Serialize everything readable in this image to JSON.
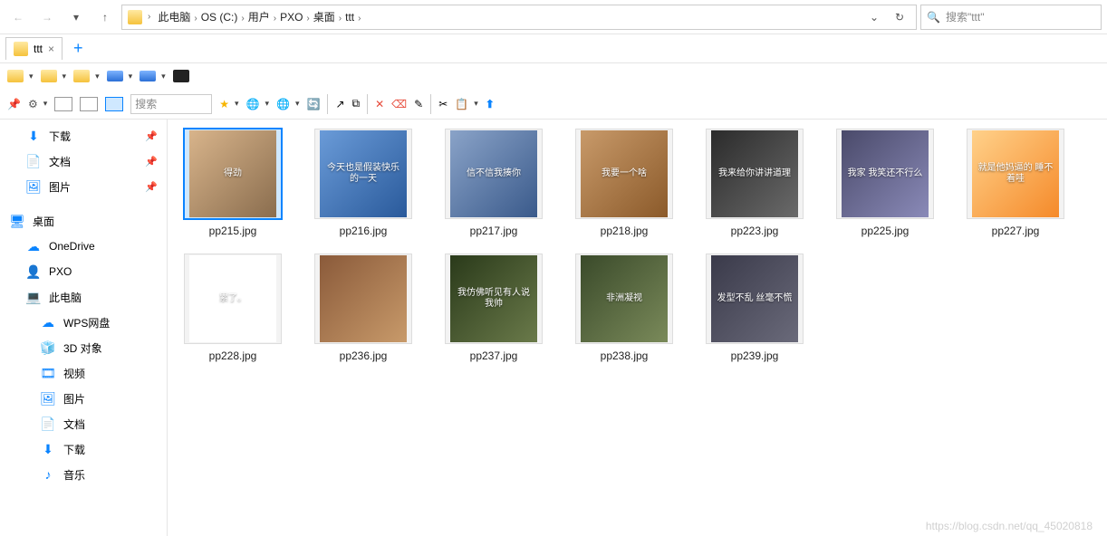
{
  "breadcrumb": [
    "此电脑",
    "OS (C:)",
    "用户",
    "PXO",
    "桌面",
    "ttt"
  ],
  "search": {
    "placeholder": "搜索\"ttt\""
  },
  "tab": {
    "label": "ttt"
  },
  "toolbar_small_search": "搜索",
  "sidebar": {
    "quick": [
      {
        "label": "下载",
        "icon": "download"
      },
      {
        "label": "文档",
        "icon": "doc"
      },
      {
        "label": "图片",
        "icon": "pic"
      }
    ],
    "desktop": "桌面",
    "desktop_children": [
      {
        "label": "OneDrive",
        "icon": "cloud"
      },
      {
        "label": "PXO",
        "icon": "user"
      },
      {
        "label": "此电脑",
        "icon": "pc"
      }
    ],
    "pc_children": [
      {
        "label": "WPS网盘",
        "icon": "cloud"
      },
      {
        "label": "3D 对象",
        "icon": "3d"
      },
      {
        "label": "视频",
        "icon": "vid"
      },
      {
        "label": "图片",
        "icon": "pic"
      },
      {
        "label": "文档",
        "icon": "doc"
      },
      {
        "label": "下载",
        "icon": "download"
      },
      {
        "label": "音乐",
        "icon": "mus"
      }
    ]
  },
  "files": [
    {
      "name": "pp215.jpg",
      "selected": true,
      "caption": "得劲",
      "cls": "c0"
    },
    {
      "name": "pp216.jpg",
      "selected": false,
      "caption": "今天也是假装快乐的一天",
      "cls": "c1"
    },
    {
      "name": "pp217.jpg",
      "selected": false,
      "caption": "信不信我揍你",
      "cls": "c2"
    },
    {
      "name": "pp218.jpg",
      "selected": false,
      "caption": "我要一个啥",
      "cls": "c3"
    },
    {
      "name": "pp223.jpg",
      "selected": false,
      "caption": "我来给你讲讲道理",
      "cls": "c4"
    },
    {
      "name": "pp225.jpg",
      "selected": false,
      "caption": "我家 我笑还不行么",
      "cls": "c5"
    },
    {
      "name": "pp227.jpg",
      "selected": false,
      "caption": "就是他妈逼的 睡不着哇",
      "cls": "c6"
    },
    {
      "name": "pp228.jpg",
      "selected": false,
      "caption": "累了。",
      "cls": "c7"
    },
    {
      "name": "pp236.jpg",
      "selected": false,
      "caption": "",
      "cls": "c8"
    },
    {
      "name": "pp237.jpg",
      "selected": false,
      "caption": "我仿佛听见有人说我帅",
      "cls": "c9"
    },
    {
      "name": "pp238.jpg",
      "selected": false,
      "caption": "非洲凝视",
      "cls": "c10"
    },
    {
      "name": "pp239.jpg",
      "selected": false,
      "caption": "发型不乱 丝毫不慌",
      "cls": "c11"
    }
  ],
  "watermark": "https://blog.csdn.net/qq_45020818"
}
